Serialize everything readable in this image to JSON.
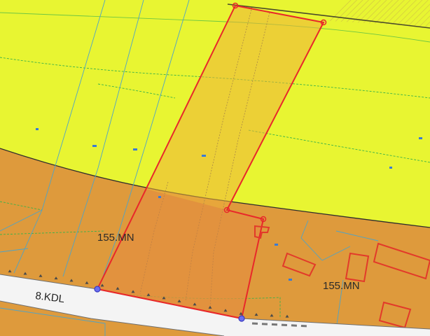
{
  "map": {
    "zone_labels": [
      "155.MN",
      "155.MN"
    ],
    "road_label": "8.KDL"
  },
  "colors": {
    "zone_yellow": "#e8f532",
    "zone_orange": "#de9a3c",
    "parcel_highlight": "#e38f3f",
    "parcel_outline": "#e8282a",
    "road": "#f4f4f4",
    "cadastral_lines": "#4fa3c7",
    "contours": "#3ab24a"
  }
}
